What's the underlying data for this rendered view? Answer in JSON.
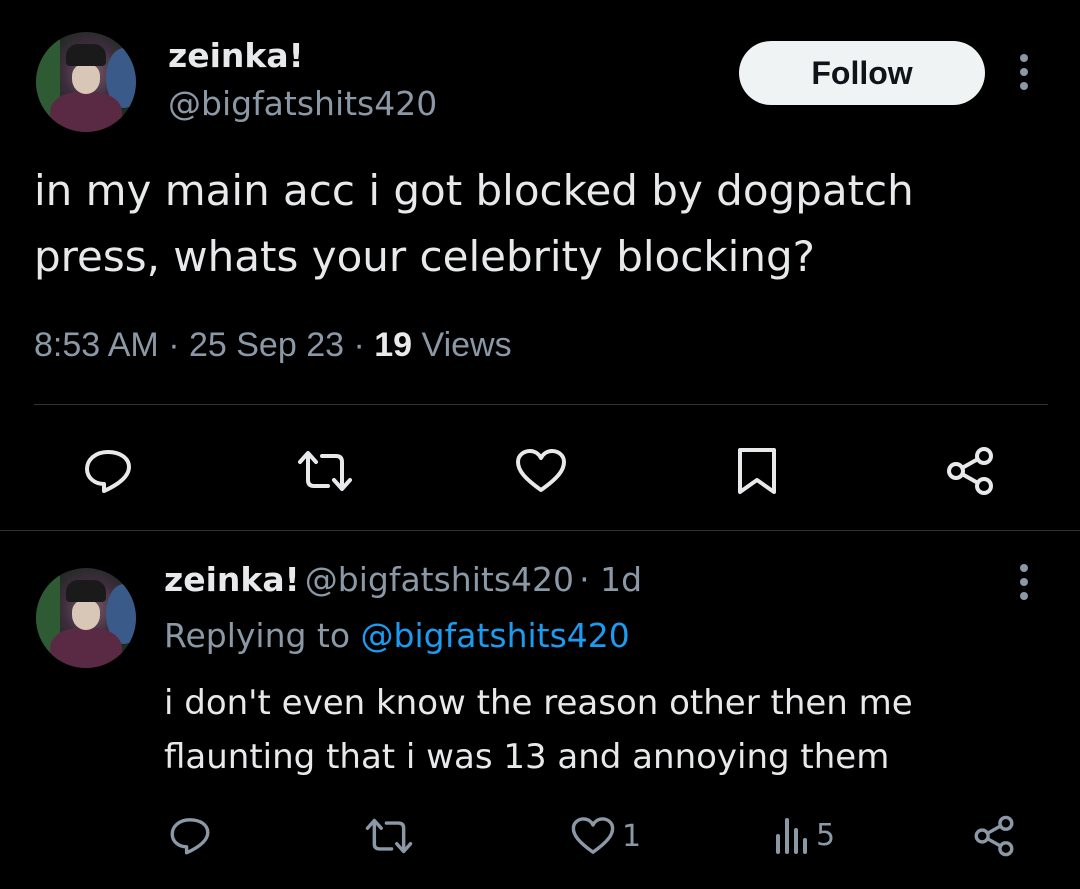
{
  "main_tweet": {
    "display_name": "zeinka!",
    "handle": "@bigfatshits420",
    "follow_label": "Follow",
    "more_icon": "more-dots-icon",
    "text_line1": "in my main acc i got blocked by dogpatch",
    "text_line2": "press, whats your celebrity blocking?",
    "time": "8:53 AM",
    "date": "25 Sep 23",
    "views_count": "19",
    "views_label": "Views",
    "actions": [
      "reply-icon",
      "retweet-icon",
      "like-icon",
      "bookmark-icon",
      "share-icon"
    ]
  },
  "reply_tweet": {
    "display_name": "zeinka!",
    "handle": "@bigfatshits420",
    "age": "1d",
    "replying_prefix": "Replying to",
    "replying_handle": "@bigfatshits420",
    "text_line1": "i don't even know the reason other then me",
    "text_line2": "flaunting that i was 13 and annoying them",
    "like_count": "1",
    "views_count": "5"
  },
  "colors": {
    "background": "#000000",
    "text": "#e7e9ea",
    "muted": "#8b98a5",
    "link": "#1d9bf0",
    "divider": "#2f3336",
    "follow_button": "#eff3f4"
  }
}
